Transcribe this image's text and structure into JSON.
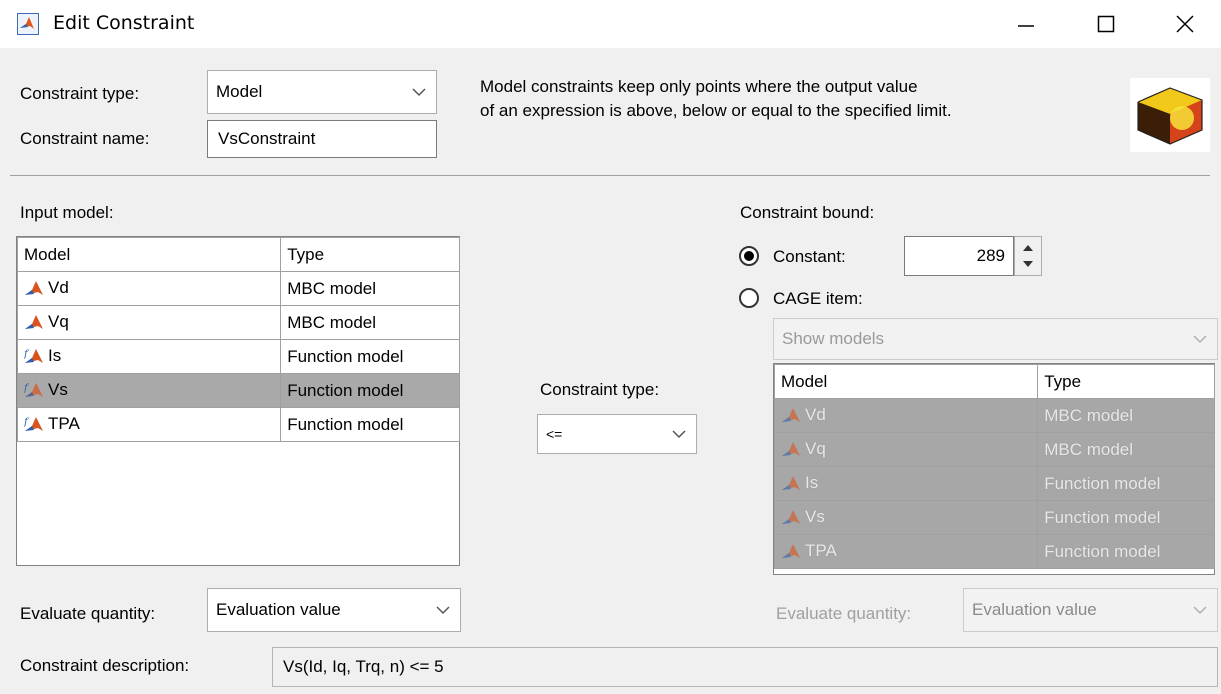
{
  "window": {
    "title": "Edit Constraint"
  },
  "header": {
    "constraint_type_label": "Constraint type:",
    "constraint_type_value": "Model",
    "constraint_name_label": "Constraint name:",
    "constraint_name_value": "VsConstraint",
    "description_line1": "Model constraints keep only points where the output value",
    "description_line2": "of an expression is above, below or equal to the specified limit."
  },
  "input_model": {
    "label": "Input model:",
    "columns": [
      "Model",
      "Type"
    ],
    "rows": [
      {
        "model": "Vd",
        "type": "MBC model"
      },
      {
        "model": "Vq",
        "type": "MBC model"
      },
      {
        "model": "Is",
        "type": "Function model"
      },
      {
        "model": "Vs",
        "type": "Function model",
        "selected": true
      },
      {
        "model": "TPA",
        "type": "Function model"
      }
    ]
  },
  "middle": {
    "constraint_type_label": "Constraint type:",
    "constraint_type_value": "<="
  },
  "bound": {
    "label": "Constraint bound:",
    "constant_label": "Constant:",
    "constant_value": "289",
    "cage_label": "CAGE item:",
    "show_models": "Show models",
    "columns": [
      "Model",
      "Type"
    ],
    "rows": [
      {
        "model": "Vd",
        "type": "MBC model"
      },
      {
        "model": "Vq",
        "type": "MBC model"
      },
      {
        "model": "Is",
        "type": "Function model"
      },
      {
        "model": "Vs",
        "type": "Function model"
      },
      {
        "model": "TPA",
        "type": "Function model"
      }
    ]
  },
  "evaluate": {
    "left_label": "Evaluate quantity:",
    "left_value": "Evaluation value",
    "right_label": "Evaluate quantity:",
    "right_value": "Evaluation value"
  },
  "footer": {
    "description_label": "Constraint description:",
    "description_value": "Vs(Id, Iq, Trq, n) <= 5"
  }
}
